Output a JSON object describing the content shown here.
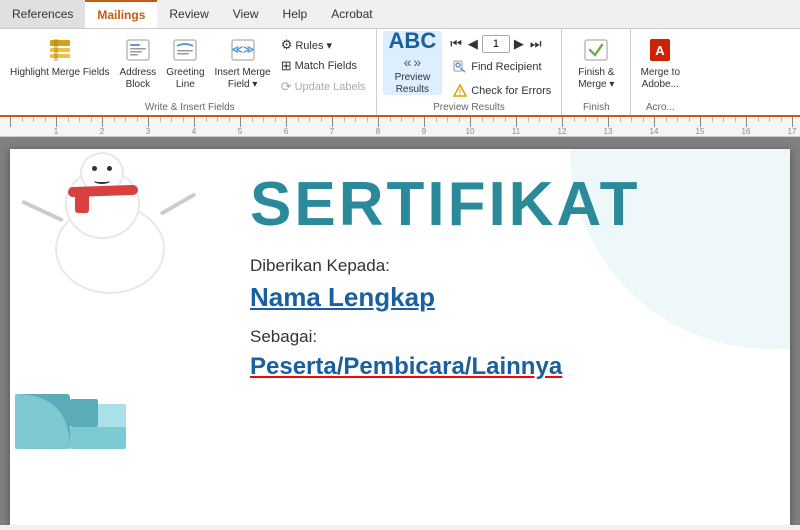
{
  "tabs": [
    {
      "label": "References",
      "active": false
    },
    {
      "label": "Mailings",
      "active": true
    },
    {
      "label": "Review",
      "active": false
    },
    {
      "label": "View",
      "active": false
    },
    {
      "label": "Help",
      "active": false
    },
    {
      "label": "Acrobat",
      "active": false
    }
  ],
  "groups": {
    "writeInsert": {
      "label": "Write & Insert Fields",
      "buttons": [
        {
          "id": "highlight",
          "label": "Highlight\nMerge Fields",
          "icon": "highlight"
        },
        {
          "id": "address",
          "label": "Address\nBlock",
          "icon": "address"
        },
        {
          "id": "greeting",
          "label": "Greeting\nLine",
          "icon": "greeting"
        },
        {
          "id": "insert-merge",
          "label": "Insert Merge\nField ▾",
          "icon": "insert"
        }
      ],
      "smallButtons": [
        {
          "id": "rules",
          "label": "Rules ▾",
          "icon": "⚙"
        },
        {
          "id": "match",
          "label": "Match Fields",
          "icon": "⊞"
        },
        {
          "id": "update",
          "label": "Update Labels",
          "icon": "⟳",
          "disabled": true
        }
      ]
    },
    "previewResults": {
      "label": "Preview Results",
      "abcLabel": "ABC",
      "previewBtn": "Preview\nResults",
      "navCurrent": "1",
      "rightButtons": [
        {
          "id": "find-recipient",
          "label": "Find Recipient",
          "icon": "🔍"
        },
        {
          "id": "check-errors",
          "label": "Check for Errors",
          "icon": "⚠"
        }
      ]
    },
    "finish": {
      "label": "Finish",
      "buttons": [
        {
          "id": "finish-merge",
          "label": "Finish &\nMerge ▾",
          "icon": "finish"
        }
      ]
    },
    "acrobat": {
      "label": "Acro...",
      "buttons": [
        {
          "id": "merge-adobe",
          "label": "Merge to\nAdobe...",
          "icon": "pdf"
        }
      ]
    }
  },
  "ruler": {
    "marks": [
      1,
      2,
      3,
      4,
      5,
      6,
      7,
      8,
      9,
      10,
      11,
      12,
      13,
      14,
      15,
      16,
      17
    ]
  },
  "certificate": {
    "title": "SERTIFIKAT",
    "diberikan": "Diberikan Kepada:",
    "name": "Nama Lengkap",
    "sebagai": "Sebagai:",
    "role": "Peserta/Pembicara/Lainnya"
  }
}
